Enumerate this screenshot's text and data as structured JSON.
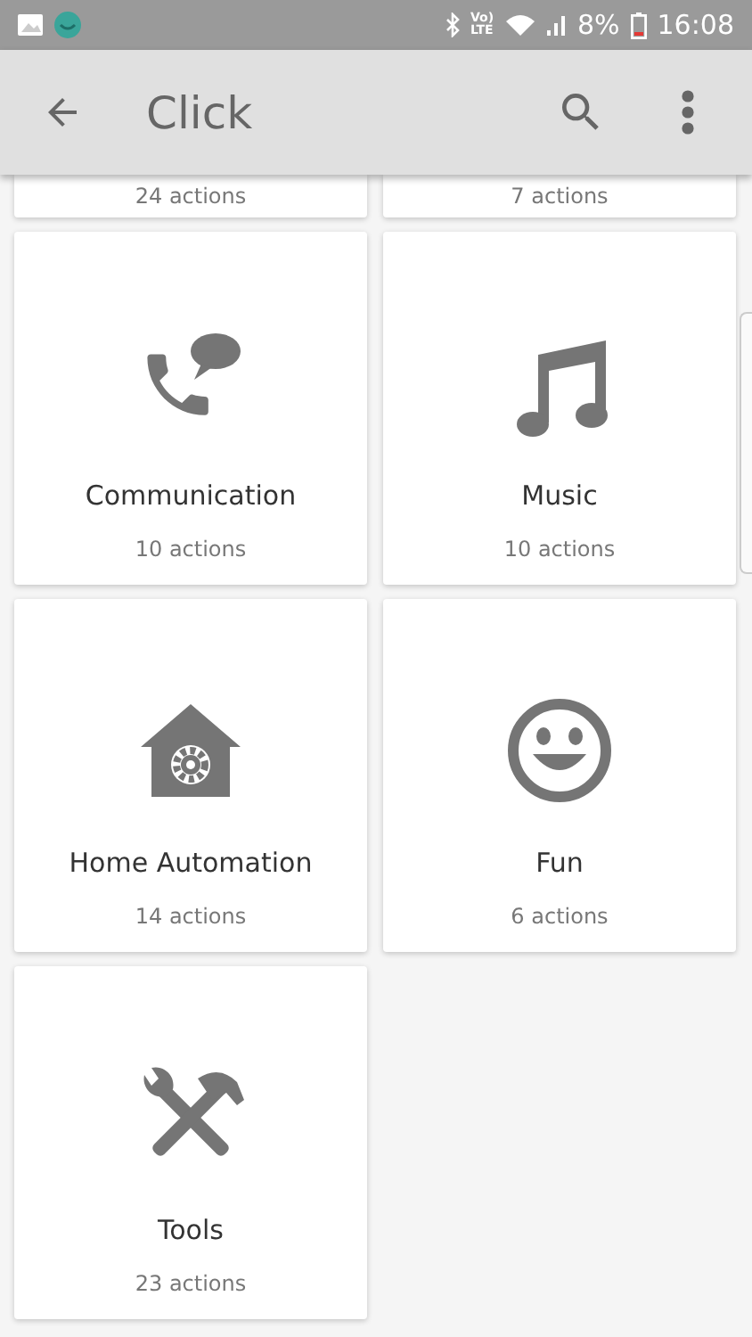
{
  "status_bar": {
    "network": "Vo) LTE",
    "battery": "8%",
    "time": "16:08"
  },
  "app_bar": {
    "title": "Click"
  },
  "cards": [
    {
      "kind": "partial",
      "count": "24 actions"
    },
    {
      "kind": "partial",
      "count": "7 actions"
    },
    {
      "kind": "full",
      "label": "Communication",
      "count": "10 actions"
    },
    {
      "kind": "full",
      "label": "Music",
      "count": "10 actions"
    },
    {
      "kind": "full",
      "label": "Home Automation",
      "count": "14 actions"
    },
    {
      "kind": "full",
      "label": "Fun",
      "count": "6 actions"
    },
    {
      "kind": "full",
      "label": "Tools",
      "count": "23 actions"
    }
  ]
}
